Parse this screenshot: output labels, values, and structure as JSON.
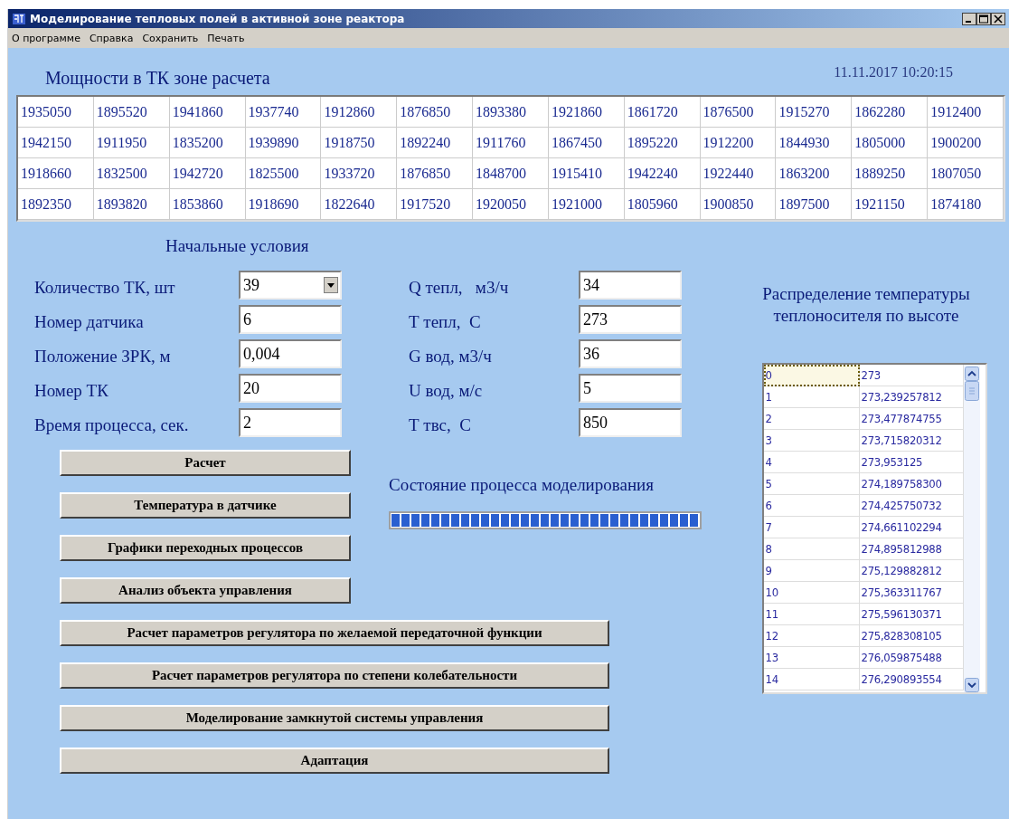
{
  "window": {
    "title": "Моделирование тепловых полей в активной зоне реактора"
  },
  "menu": [
    "О программе",
    "Справка",
    "Сохранить",
    "Печать"
  ],
  "powers": {
    "title": "Мощности в ТК зоне расчета",
    "datetime": "11.11.2017 10:20:15",
    "rows": [
      [
        "1935050",
        "1895520",
        "1941860",
        "1937740",
        "1912860",
        "1876850",
        "1893380",
        "1921860",
        "1861720",
        "1876500",
        "1915270",
        "1862280",
        "1912400"
      ],
      [
        "1942150",
        "1911950",
        "1835200",
        "1939890",
        "1918750",
        "1892240",
        "1911760",
        "1867450",
        "1895220",
        "1912200",
        "1844930",
        "1805000",
        "1900200"
      ],
      [
        "1918660",
        "1832500",
        "1942720",
        "1825500",
        "1933720",
        "1876850",
        "1848700",
        "1915410",
        "1942240",
        "1922440",
        "1863200",
        "1889250",
        "1807050"
      ],
      [
        "1892350",
        "1893820",
        "1853860",
        "1918690",
        "1822640",
        "1917520",
        "1920050",
        "1921000",
        "1805960",
        "1900850",
        "1897500",
        "1921150",
        "1874180"
      ]
    ]
  },
  "initial_conditions": {
    "title": "Начальные условия",
    "fields_left": [
      {
        "label": "Количество ТК, шт",
        "value": "39",
        "kind": "dropdown"
      },
      {
        "label": "Номер датчика",
        "value": "6",
        "kind": "text"
      },
      {
        "label": "Положение ЗРК, м",
        "value": "0,004",
        "kind": "text"
      },
      {
        "label": "Номер ТК",
        "value": "20",
        "kind": "text"
      },
      {
        "label": "Время процесса, сек.",
        "value": "2",
        "kind": "text"
      }
    ],
    "fields_right": [
      {
        "label": "Q тепл,   м3/ч",
        "value": "34",
        "kind": "text"
      },
      {
        "label": "Т тепл,  С",
        "value": "273",
        "kind": "text"
      },
      {
        "label": "G вод, м3/ч",
        "value": "36",
        "kind": "text"
      },
      {
        "label": "U вод, м/с",
        "value": "5",
        "kind": "text"
      },
      {
        "label": "Т твс,  С",
        "value": "850",
        "kind": "text"
      }
    ]
  },
  "buttons_short": [
    "Расчет",
    "Температура в датчике",
    "Графики переходных процессов",
    "Анализ объекта управления"
  ],
  "buttons_wide": [
    "Расчет параметров регулятора по желаемой передаточной функции",
    "Расчет параметров регулятора по степени колебательности",
    "Моделирование замкнутой системы управления",
    "Адаптация"
  ],
  "progress": {
    "label": "Состояние процесса моделирования",
    "level": 1
  },
  "distribution": {
    "title": "Распределение температуры теплоносителя по высоте",
    "rows": [
      {
        "index": "0",
        "value": "273",
        "selected": true
      },
      {
        "index": "1",
        "value": "273,239257812",
        "selected": false
      },
      {
        "index": "2",
        "value": "273,477874755",
        "selected": false
      },
      {
        "index": "3",
        "value": "273,715820312",
        "selected": false
      },
      {
        "index": "4",
        "value": "273,953125",
        "selected": false
      },
      {
        "index": "5",
        "value": "274,189758300",
        "selected": false
      },
      {
        "index": "6",
        "value": "274,425750732",
        "selected": false
      },
      {
        "index": "7",
        "value": "274,661102294",
        "selected": false
      },
      {
        "index": "8",
        "value": "274,895812988",
        "selected": false
      },
      {
        "index": "9",
        "value": "275,129882812",
        "selected": false
      },
      {
        "index": "10",
        "value": "275,363311767",
        "selected": false
      },
      {
        "index": "11",
        "value": "275,596130371",
        "selected": false
      },
      {
        "index": "12",
        "value": "275,828308105",
        "selected": false
      },
      {
        "index": "13",
        "value": "276,059875488",
        "selected": false
      },
      {
        "index": "14",
        "value": "276,290893554",
        "selected": false
      }
    ]
  }
}
